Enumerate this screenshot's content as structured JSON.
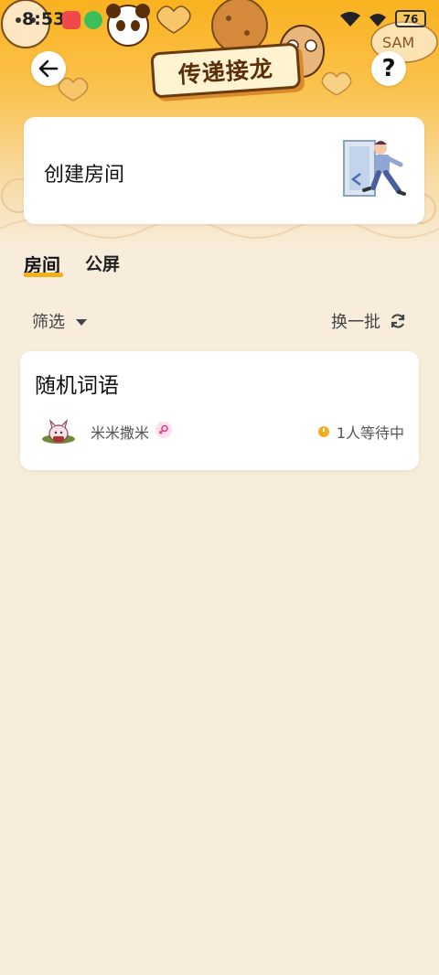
{
  "status_bar": {
    "time": "8:53",
    "battery": "76"
  },
  "header": {
    "title": "传递接龙",
    "back_icon": "arrow-left-icon",
    "help_label": "?"
  },
  "create_room": {
    "label": "创建房间"
  },
  "tabs": [
    {
      "label": "房间",
      "active": true
    },
    {
      "label": "公屏",
      "active": false
    }
  ],
  "filter": {
    "label": "筛选"
  },
  "refresh": {
    "label": "换一批"
  },
  "rooms": [
    {
      "title": "随机词语",
      "owner": "米米撒米",
      "owner_gender": "female",
      "status": "1人等待中"
    }
  ],
  "colors": {
    "accent": "#f2b01e",
    "background": "#f8eddc",
    "banner_top": "#f9b21f"
  }
}
